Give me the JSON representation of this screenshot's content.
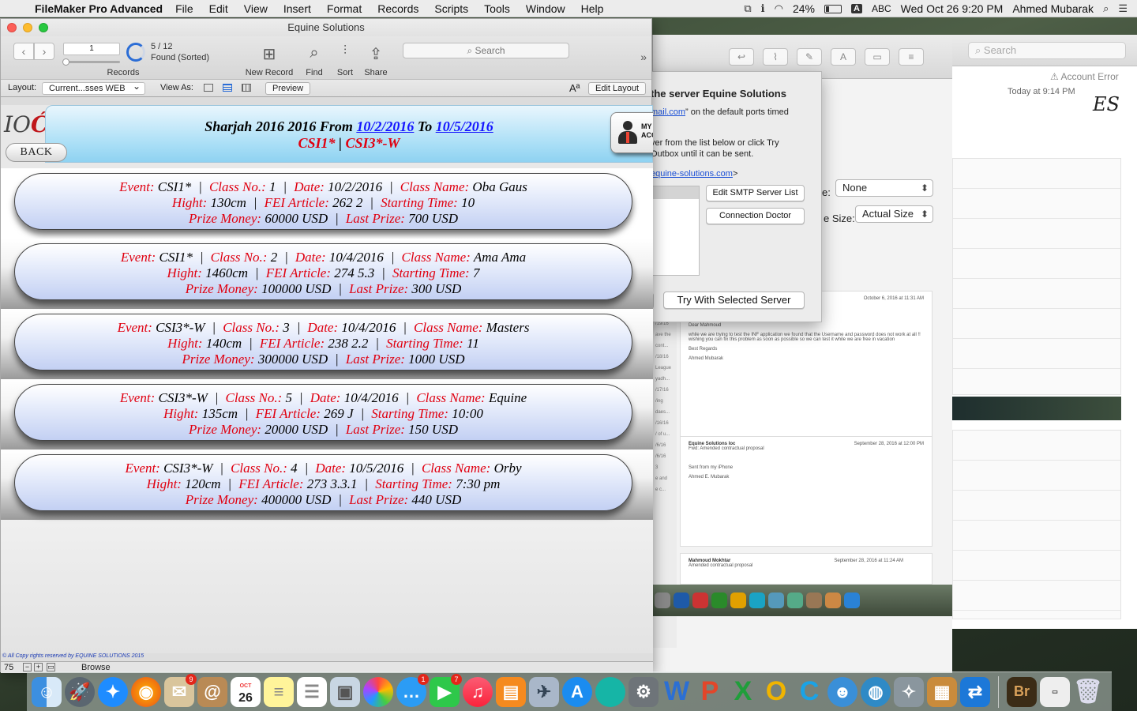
{
  "menubar": {
    "app_name": "FileMaker Pro Advanced",
    "items": [
      "File",
      "Edit",
      "View",
      "Insert",
      "Format",
      "Records",
      "Scripts",
      "Tools",
      "Window",
      "Help"
    ],
    "battery": "24%",
    "input_source": "ABC",
    "clock": "Wed Oct 26  9:20 PM",
    "user": "Ahmed Mubarak"
  },
  "window": {
    "title": "Equine Solutions"
  },
  "toolbar": {
    "record_number": "1",
    "records_label": "Records",
    "found_count": "5 / 12",
    "found_status": "Found (Sorted)",
    "new_record": "New Record",
    "find": "Find",
    "sort": "Sort",
    "share": "Share",
    "search_placeholder": "Search"
  },
  "layoutbar": {
    "layout_label": "Layout:",
    "layout_value": "Current...sses WEB",
    "view_as_label": "View As:",
    "preview": "Preview",
    "edit_layout": "Edit Layout"
  },
  "header": {
    "prefix": "Sharjah 2016 2016 From ",
    "date_from": "10/2/2016",
    "middle": " To ",
    "date_to": "10/5/2016",
    "classes_a": "CSI1*",
    "divider": " | ",
    "classes_b": "CSI3*-W",
    "account_line1": "MY",
    "account_line2": "ACCOUNT",
    "back": "BACK"
  },
  "labels": {
    "event": "Event:",
    "class_no": "Class No.:",
    "date": "Date:",
    "class_name": "Class Name:",
    "hight": "Hight:",
    "fei": "FEI Article:",
    "starting": "Starting Time:",
    "prize": "Prize Money:",
    "last": "Last Prize:",
    "sep": "|"
  },
  "records": [
    {
      "event": "CSI1*",
      "class_no": "1",
      "date": "10/2/2016",
      "class_name": "Oba Gaus",
      "hight": "130cm",
      "fei": "262 2",
      "starting": "10",
      "prize": "60000 USD",
      "last": "700 USD"
    },
    {
      "event": "CSI1*",
      "class_no": "2",
      "date": "10/4/2016",
      "class_name": "Ama Ama",
      "hight": "1460cm",
      "fei": "274 5.3",
      "starting": "7",
      "prize": "100000 USD",
      "last": "300 USD"
    },
    {
      "event": "CSI3*-W",
      "class_no": "3",
      "date": "10/4/2016",
      "class_name": "Masters",
      "hight": "140cm",
      "fei": "238 2.2",
      "starting": "11",
      "prize": "300000 USD",
      "last": "1000 USD"
    },
    {
      "event": "CSI3*-W",
      "class_no": "5",
      "date": "10/4/2016",
      "class_name": "Equine",
      "hight": "135cm",
      "fei": "269 J",
      "starting": "10:00",
      "prize": "20000 USD",
      "last": "150 USD"
    },
    {
      "event": "CSI3*-W",
      "class_no": "4",
      "date": "10/5/2016",
      "class_name": "Orby",
      "hight": "120cm",
      "fei": "273 3.3.1",
      "starting": "7:30 pm",
      "prize": "400000 USD",
      "last": "440 USD"
    }
  ],
  "footer": {
    "copyright": "All Copy rights reserved by EQUINE SOLUTIONS 2015",
    "zoom": "75",
    "mode": "Browse"
  },
  "dialog": {
    "title": "the server Equine Solutions",
    "line1_link": "mail.com",
    "line1_rest": "” on the default ports timed",
    "line2": "ver from the list below or click Try",
    "line3": "Outbox until it can be sent.",
    "email_link": "equine-solutions.com",
    "email_suffix": ">",
    "edit_smtp": "Edit SMTP Server List",
    "connection_doctor": "Connection Doctor",
    "try_selected": "Try With Selected Server"
  },
  "prefs": {
    "field1_suffix": "e:",
    "field1_value": "None",
    "field2_label": "e Size:",
    "field2_value": "Actual Size"
  },
  "mail": {
    "search": "Search",
    "account_error": "Account Error",
    "today": "Today at 9:14 PM",
    "logo": "ES",
    "greeting": "Dear Mahmoud",
    "body": "while we are trying to test the INF application we found that the Username and password does not work at all !! wishing you can fix this problem as soon as possible so we can test it while we are free in vacation",
    "regards": "Best Regards",
    "signature": "Ahmed Mubarak",
    "sender2": "Equine Solutions loc",
    "subject2": "Fwd: Amended contractual proposal",
    "sent": "Sent from my iPhone",
    "signature2": "Ahmed E. Mubarak",
    "sender3": "Mahmoud Mokhtar",
    "subject3": "Amended contractual proposal",
    "date1": "October 6, 2016 at 11:31 AM",
    "date2": "September 28, 2016 at 12:00 PM",
    "date3": "September 28, 2016 at 11:24 AM"
  },
  "dock": {
    "calendar_day": "26",
    "calendar_month": "OCT",
    "badges": {
      "mail": "9",
      "messages": "1",
      "facetime": "7"
    }
  },
  "colors": {
    "label_red": "#e00010",
    "date_blue": "#1515ff",
    "pill_light": "#e6ecfb",
    "pill_dark": "#c3d0f3",
    "header_blue": "#a8def6"
  }
}
